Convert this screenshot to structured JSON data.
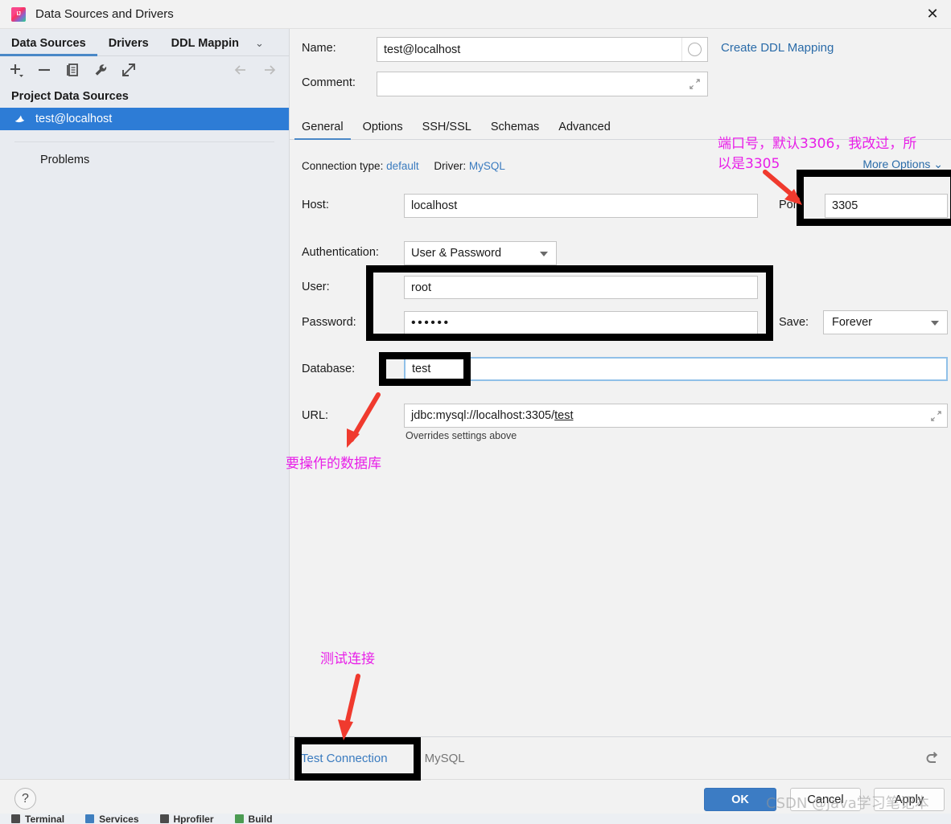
{
  "window": {
    "title": "Data Sources and Drivers",
    "app_icon": "intellij-idea-icon",
    "close_icon": "close-icon"
  },
  "left_panel": {
    "tabs": [
      {
        "label": "Data Sources",
        "active": true
      },
      {
        "label": "Drivers",
        "active": false
      },
      {
        "label": "DDL Mappin",
        "active": false
      }
    ],
    "tabs_overflow_icon": "chevron-down-icon",
    "toolbar": [
      {
        "name": "add-icon",
        "glyph": "+"
      },
      {
        "name": "remove-icon",
        "glyph": "−"
      },
      {
        "name": "copy-icon",
        "glyph": "copy"
      },
      {
        "name": "wrench-icon",
        "glyph": "wrench"
      },
      {
        "name": "open-external-icon",
        "glyph": "external"
      }
    ],
    "nav": [
      {
        "name": "back-arrow-icon",
        "glyph": "←"
      },
      {
        "name": "forward-arrow-icon",
        "glyph": "→"
      }
    ],
    "section_title": "Project Data Sources",
    "data_source": {
      "label": "test@localhost",
      "icon": "mysql-dolphin-icon",
      "selected": true
    },
    "problems_label": "Problems"
  },
  "form": {
    "name_label": "Name:",
    "name_value": "test@localhost",
    "name_color_icon": "color-circle-icon",
    "comment_label": "Comment:",
    "comment_value": "",
    "comment_expand_icon": "expand-icon",
    "create_ddl_mapping_link": "Create DDL Mapping",
    "tabs": [
      {
        "label": "General",
        "active": true
      },
      {
        "label": "Options",
        "active": false
      },
      {
        "label": "SSH/SSL",
        "active": false
      },
      {
        "label": "Schemas",
        "active": false
      },
      {
        "label": "Advanced",
        "active": false
      }
    ],
    "connection_type_label": "Connection type:",
    "connection_type_value": "default",
    "driver_label": "Driver:",
    "driver_value": "MySQL",
    "more_options_label": "More Options",
    "more_options_icon": "chevron-down-icon",
    "host_label": "Host:",
    "host_value": "localhost",
    "port_label": "Port:",
    "port_value": "3305",
    "authentication_label": "Authentication:",
    "authentication_value": "User & Password",
    "authentication_caret_icon": "chevron-down-icon",
    "user_label": "User:",
    "user_value": "root",
    "password_label": "Password:",
    "password_value": "••••••",
    "save_label": "Save:",
    "save_value": "Forever",
    "save_caret_icon": "chevron-down-icon",
    "database_label": "Database:",
    "database_value": "test",
    "url_label": "URL:",
    "url_value_prefix": "jdbc:mysql://localhost:3305/",
    "url_value_underlined": "test",
    "url_expand_icon": "expand-icon",
    "url_note": "Overrides settings above"
  },
  "dialog_bottom": {
    "test_connection_label": "Test Connection",
    "driver_name": "MySQL",
    "reset_icon": "undo-arrow-icon"
  },
  "footer": {
    "help_label": "?",
    "help_icon": "help-icon",
    "ok_label": "OK",
    "cancel_label": "Cancel",
    "apply_label": "Apply"
  },
  "ide_strip": [
    {
      "label": "Terminal",
      "icon": "terminal-icon"
    },
    {
      "label": "Services",
      "icon": "services-icon"
    },
    {
      "label": "Hprofiler",
      "icon": "profiler-icon"
    },
    {
      "label": "Build",
      "icon": "build-icon"
    }
  ],
  "annotations": {
    "port_note": "端口号，默认3306，我改过，所\n以是3305",
    "database_note": "要操作的数据库",
    "test_connection_note": "测试连接",
    "highlight_color": "#000000",
    "note_color": "#e81fe8",
    "arrow_color": "#f03a2e"
  },
  "watermark": "CSDN @java学习笔记本"
}
